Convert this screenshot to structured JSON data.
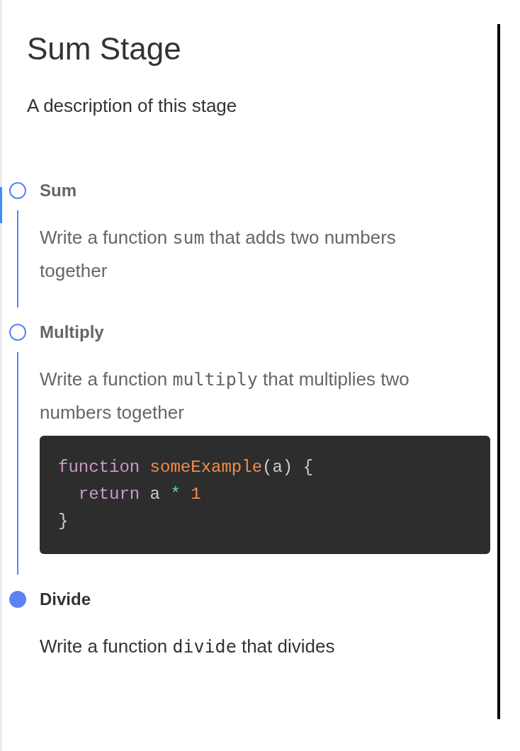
{
  "title": "Sum Stage",
  "description": "A description of this stage",
  "steps": [
    {
      "title": "Sum",
      "active": false,
      "highlighted": true,
      "description": [
        {
          "kind": "text",
          "text": "Write a function "
        },
        {
          "kind": "code",
          "text": "sum"
        },
        {
          "kind": "text",
          "text": " that adds two numbers together"
        }
      ]
    },
    {
      "title": "Multiply",
      "active": false,
      "highlighted": false,
      "description": [
        {
          "kind": "text",
          "text": "Write a function "
        },
        {
          "kind": "code",
          "text": "multiply"
        },
        {
          "kind": "text",
          "text": " that multiplies two numbers together"
        }
      ],
      "code_block": {
        "lines": [
          [
            {
              "kind": "keyword",
              "text": "function"
            },
            {
              "kind": "function",
              "text": " someExample"
            },
            {
              "kind": "plain",
              "text": "(a) {"
            }
          ],
          [
            {
              "kind": "keyword",
              "text": "  return"
            },
            {
              "kind": "plain",
              "text": " a "
            },
            {
              "kind": "operator",
              "text": "*"
            },
            {
              "kind": "number",
              "text": " 1"
            }
          ],
          [
            {
              "kind": "plain",
              "text": "}"
            }
          ]
        ]
      }
    },
    {
      "title": "Divide",
      "active": true,
      "highlighted": false,
      "description": [
        {
          "kind": "text",
          "text": "Write a function "
        },
        {
          "kind": "code",
          "text": "divide"
        },
        {
          "kind": "text",
          "text": " that divides"
        }
      ]
    }
  ]
}
